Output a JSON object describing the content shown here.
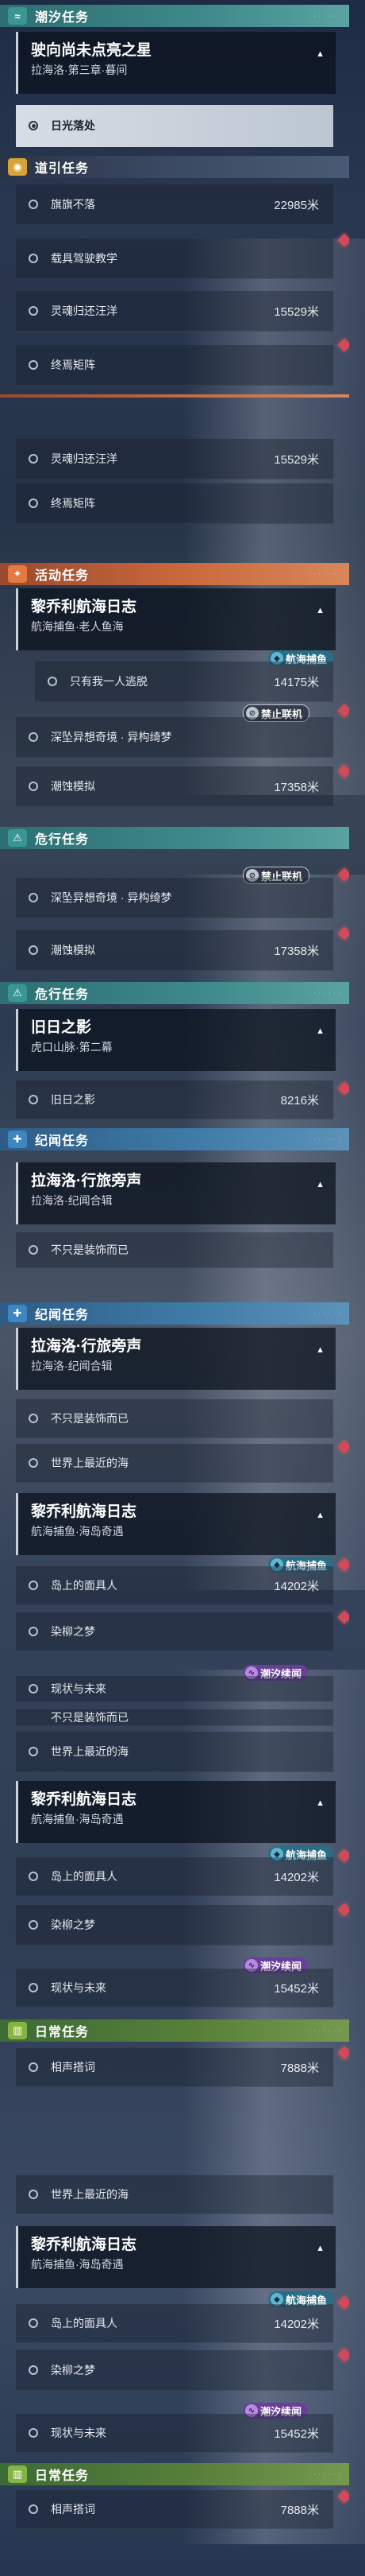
{
  "categories": {
    "chaoxi": "潮汐任务",
    "daoyin": "道引任务",
    "huodong": "活动任务",
    "weixing": "危行任务",
    "jiwen": "纪闻任务",
    "richang": "日常任务"
  },
  "quests": {
    "shi_xiang": {
      "title": "驶向尚未点亮之星",
      "sub": "拉海洛·第三章·暮间"
    },
    "liqiao": {
      "title": "黎乔利航海日志",
      "sub_old": "航海捕鱼·老人鱼海",
      "sub": "航海捕鱼·海岛奇遇"
    },
    "jiuri": {
      "title": "旧日之影",
      "sub": "虎口山脉·第二幕"
    },
    "lahailuo": {
      "title": "拉海洛·行旅旁声",
      "sub": "拉海洛·纪闻合辑"
    }
  },
  "steps": {
    "riguang": "日光落处",
    "qizhi": "旗旗不落",
    "zaiju": "载具驾驶教学",
    "linghun": "灵魂归还汪洋",
    "zhongyan": "终焉矩阵",
    "zhiyou": "只有我一人逃脱",
    "shenzhi": "深坠异想奇境 · 异构绮梦",
    "chaoxu": "潮蚀模拟",
    "jiuri_step": "旧日之影",
    "bushi": "不只是装饰而已",
    "shijie": "世界上最近的海",
    "daoshang": "岛上的面具人",
    "ranliu": "染柳之梦",
    "xianzhuang": "现状与未来",
    "xiangsheng": "相声搭词"
  },
  "distances": {
    "qizhi": "22985米",
    "linghun": "15529米",
    "zhiyou": "14175米",
    "chaoxu": "17358米",
    "jiuri": "8216米",
    "daoshang": "14202米",
    "xianzhuang": "15452米",
    "xiangsheng": "7888米"
  },
  "tags": {
    "fish": "航海捕鱼",
    "ban": "禁止联机",
    "chao": "潮汐续闻"
  },
  "icons": {
    "chaoxi": "wave-icon",
    "daoyin": "compass-icon",
    "huodong": "activity-icon",
    "weixing": "danger-icon",
    "jiwen": "star-icon",
    "richang": "book-icon"
  },
  "colors": {
    "chaoxi": "#3a9692",
    "daoyin": "#d6a336",
    "huodong": "#e27a42",
    "jiwen": "#3e86c0",
    "richang": "#85b444",
    "marker": "#d24a5a"
  }
}
